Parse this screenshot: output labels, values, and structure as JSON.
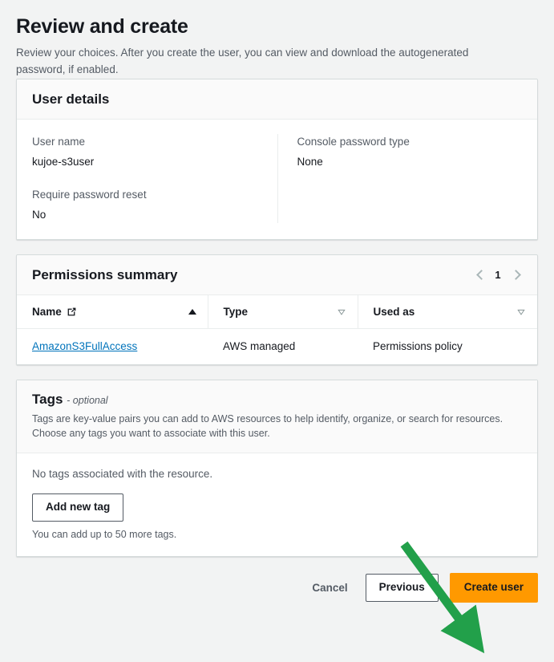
{
  "page": {
    "title": "Review and create",
    "description": "Review your choices. After you create the user, you can view and download the autogenerated password, if enabled."
  },
  "user_details": {
    "card_title": "User details",
    "fields": [
      {
        "label": "User name",
        "value": "kujoe-s3user"
      },
      {
        "label": "Console password type",
        "value": "None"
      },
      {
        "label": "Require password reset",
        "value": "No"
      }
    ]
  },
  "permissions_summary": {
    "card_title": "Permissions summary",
    "pagination": {
      "page": "1",
      "prev_icon": "chevron-left-icon",
      "next_icon": "chevron-right-icon"
    },
    "columns": [
      {
        "label": "Name",
        "icon": "external-link-icon",
        "sort": "ascending"
      },
      {
        "label": "Type",
        "sort": "none"
      },
      {
        "label": "Used as",
        "sort": "none"
      }
    ],
    "rows": [
      {
        "name": "AmazonS3FullAccess",
        "type": "AWS managed",
        "used_as": "Permissions policy"
      }
    ]
  },
  "tags": {
    "card_title": "Tags",
    "optional_label": "- optional",
    "description": "Tags are key-value pairs you can add to AWS resources to help identify, organize, or search for resources. Choose any tags you want to associate with this user.",
    "empty_text": "No tags associated with the resource.",
    "add_button": "Add new tag",
    "hint": "You can add up to 50 more tags."
  },
  "actions": {
    "cancel": "Cancel",
    "previous": "Previous",
    "create": "Create user"
  },
  "annotation": {
    "type": "arrow",
    "color": "#22a04a",
    "points_to": "create-user-button"
  },
  "colors": {
    "page_background": "#f2f3f3",
    "card_background": "#ffffff",
    "card_header_background": "#fafafa",
    "border": "#d5dbdb",
    "primary_button": "#ff9900",
    "link": "#0073bb",
    "text": "#16191f",
    "secondary_text": "#545b64",
    "annotation_green": "#22a04a"
  }
}
